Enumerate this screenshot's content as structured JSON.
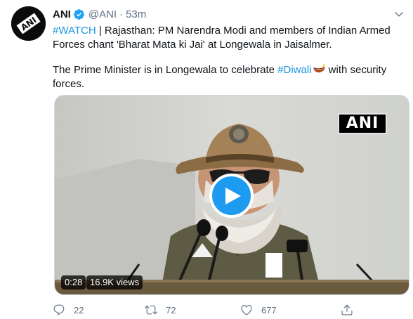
{
  "tweet": {
    "author_name": "ANI",
    "handle": "@ANI",
    "separator": "·",
    "time": "53m",
    "line1_hashtag": "#WATCH",
    "line1_text": " | Rajasthan: PM Narendra Modi and members of Indian Armed",
    "line2_text": "Forces chant 'Bharat Mata ki Jai' at Longewala in Jaisalmer.",
    "line3_text": "The Prime Minister is in Longewala to celebrate ",
    "line3_hashtag": "#Diwali",
    "line3_suffix": " with security",
    "line4_text": "forces.",
    "emoji": "diya-lamp-emoji",
    "avatar_text": "ANI"
  },
  "media": {
    "watermark": "ANI",
    "duration": "0:28",
    "views": "16.9K views"
  },
  "actions": {
    "reply_count": "22",
    "retweet_count": "72",
    "like_count": "677"
  },
  "colors": {
    "link": "#1b95e0",
    "secondary": "#5b7083",
    "play": "#1d9bf0"
  }
}
